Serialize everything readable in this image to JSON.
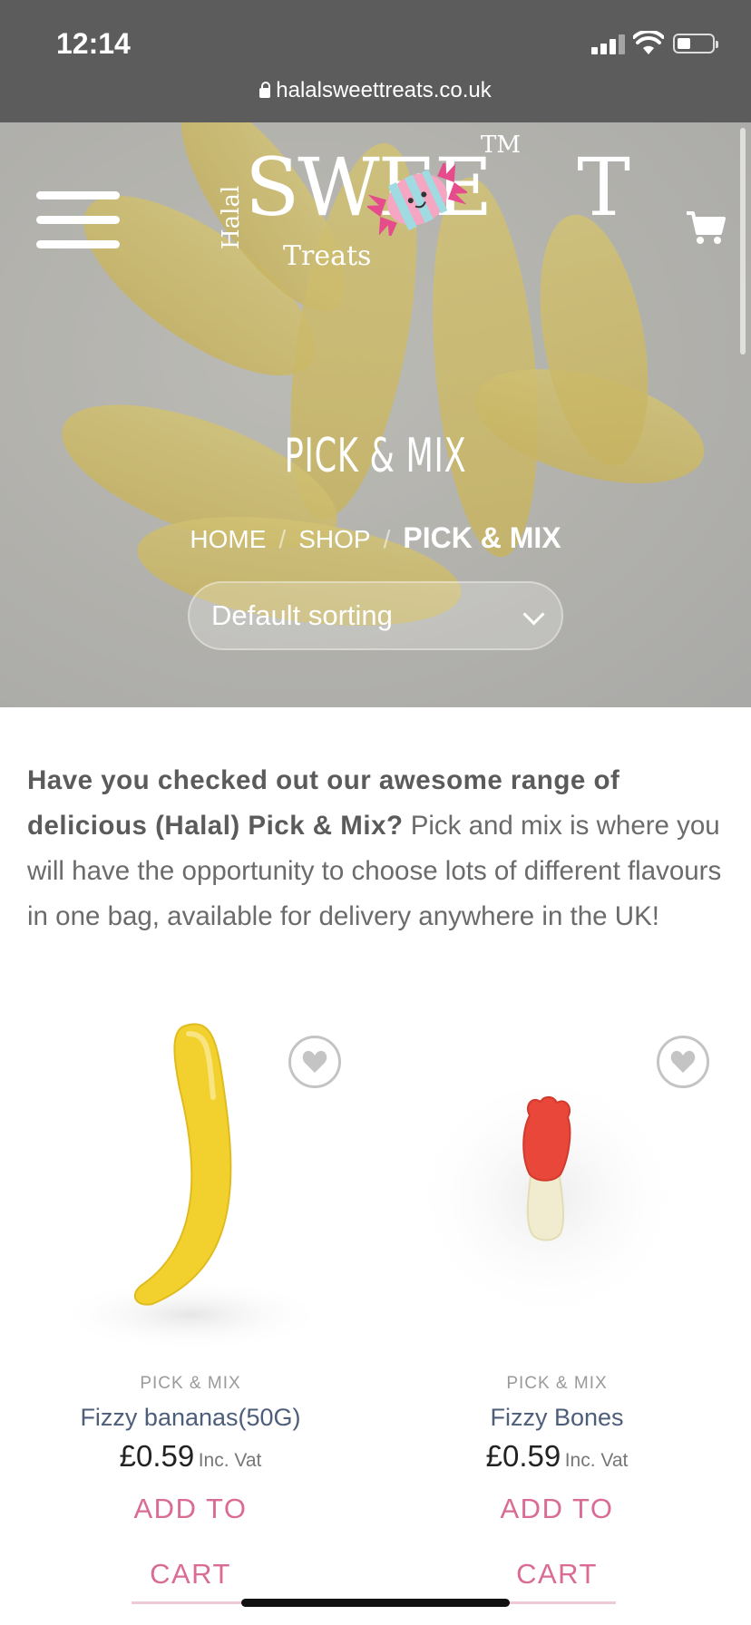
{
  "status": {
    "time": "12:14"
  },
  "browser": {
    "url": "halalsweettreats.co.uk"
  },
  "header": {
    "logo": {
      "halal": "Halal",
      "sweet": "SWEE",
      "t": "T",
      "treats": "Treats",
      "tm": "TM"
    }
  },
  "hero": {
    "title": "PICK & MIX",
    "breadcrumb": {
      "home": "HOME",
      "sep": "/",
      "shop": "SHOP",
      "current": "PICK & MIX"
    },
    "sorting": {
      "selected": "Default sorting"
    }
  },
  "description": {
    "bold": "Have you checked out our awesome range of delicious (Halal) Pick & Mix?",
    "text": " Pick and mix is where you will have the opportunity to choose lots of different flavours in one bag, available for delivery anywhere in the UK!"
  },
  "products": [
    {
      "category": "PICK & MIX",
      "name": "Fizzy bananas(50G)",
      "price": "£0.59",
      "vat": "Inc. Vat",
      "add_to": "ADD TO",
      "cart": "CART"
    },
    {
      "category": "PICK & MIX",
      "name": "Fizzy Bones",
      "price": "£0.59",
      "vat": "Inc. Vat",
      "add_to": "ADD TO",
      "cart": "CART"
    }
  ],
  "colors": {
    "statusbar": "#5c5c5c",
    "accent_pink": "#d96b95",
    "product_name": "#4d5d7a",
    "text_gray": "#6b6b6b"
  },
  "icons": [
    "lock-icon",
    "signal-icon",
    "wifi-icon",
    "battery-icon",
    "hamburger-menu-icon",
    "cart-icon",
    "candy-logo-icon",
    "chevron-down-icon",
    "heart-icon"
  ]
}
